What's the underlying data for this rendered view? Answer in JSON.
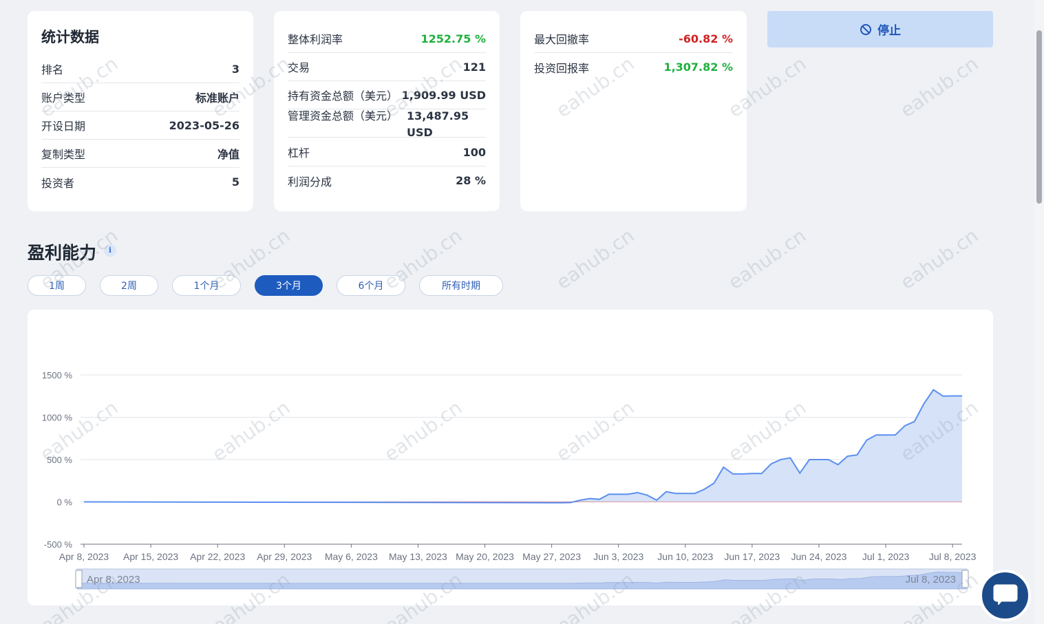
{
  "stats_card": {
    "title": "统计数据",
    "rows": [
      {
        "label": "排名",
        "value": "3"
      },
      {
        "label": "账户类型",
        "value": "标准账户"
      },
      {
        "label": "开设日期",
        "value": "2023-05-26"
      },
      {
        "label": "复制类型",
        "value": "净值"
      },
      {
        "label": "投资者",
        "value": "5"
      }
    ]
  },
  "perf_card": {
    "rows": [
      {
        "label": "整体利润率",
        "value": "1252.75 %"
      },
      {
        "label": "交易",
        "value": "121"
      },
      {
        "label": "持有资金总额（美元）",
        "value": "1,909.99 USD"
      },
      {
        "label": "管理资金总额（美元）",
        "value": "13,487.95 USD"
      },
      {
        "label": "杠杆",
        "value": "100"
      },
      {
        "label": "利润分成",
        "value": "28 %"
      }
    ]
  },
  "risk_card": {
    "rows": [
      {
        "label": "最大回撤率",
        "value": "-60.82 %"
      },
      {
        "label": "投资回报率",
        "value": "1,307.82 %"
      }
    ]
  },
  "stop_button": {
    "label": "停止",
    "icon": "ban-icon"
  },
  "profit_section": {
    "title": "盈利能力",
    "info_icon": "i",
    "tabs": [
      "1周",
      "2周",
      "1个月",
      "3个月",
      "6个月",
      "所有时期"
    ],
    "active_tab": "3个月"
  },
  "colors": {
    "positive": "#1fb03d",
    "negative": "#d12222",
    "accent": "#1d5bbf",
    "line": "#5b8ff0",
    "area": "#d3e0f8"
  },
  "watermark": "eahub.cn",
  "chart_data": {
    "type": "area",
    "title": "",
    "xlabel": "",
    "ylabel": "",
    "ylim": [
      -500,
      1500
    ],
    "y_ticks": [
      "1500 %",
      "1000 %",
      "500 %",
      "0 %",
      "-500 %"
    ],
    "y_tick_values": [
      1500,
      1000,
      500,
      0,
      -500
    ],
    "x_ticks": [
      "Apr 8, 2023",
      "Apr 15, 2023",
      "Apr 22, 2023",
      "Apr 29, 2023",
      "May 6, 2023",
      "May 13, 2023",
      "May 20, 2023",
      "May 27, 2023",
      "Jun 3, 2023",
      "Jun 10, 2023",
      "Jun 17, 2023",
      "Jun 24, 2023",
      "Jul 1, 2023",
      "Jul 8, 2023"
    ],
    "x_range": [
      "2023-04-08",
      "2023-07-09"
    ],
    "grid": true,
    "zoom_start_label": "Apr 8, 2023",
    "zoom_end_label": "Jul 8, 2023",
    "series": [
      {
        "x": [
          "2023-04-08",
          "2023-05-27",
          "2023-05-28",
          "2023-05-29",
          "2023-05-30",
          "2023-05-31",
          "2023-06-01",
          "2023-06-02",
          "2023-06-03",
          "2023-06-04",
          "2023-06-05",
          "2023-06-06",
          "2023-06-07",
          "2023-06-08",
          "2023-06-09",
          "2023-06-10",
          "2023-06-11",
          "2023-06-12",
          "2023-06-13",
          "2023-06-14",
          "2023-06-15",
          "2023-06-16",
          "2023-06-17",
          "2023-06-18",
          "2023-06-19",
          "2023-06-20",
          "2023-06-21",
          "2023-06-22",
          "2023-06-23",
          "2023-06-24",
          "2023-06-25",
          "2023-06-26",
          "2023-06-27",
          "2023-06-28",
          "2023-06-29",
          "2023-06-30",
          "2023-07-01",
          "2023-07-02",
          "2023-07-03",
          "2023-07-04",
          "2023-07-05",
          "2023-07-06",
          "2023-07-07",
          "2023-07-08",
          "2023-07-09"
        ],
        "values": [
          0,
          -10,
          -10,
          -8,
          20,
          40,
          30,
          90,
          90,
          90,
          110,
          80,
          20,
          120,
          100,
          100,
          100,
          150,
          220,
          410,
          330,
          330,
          335,
          335,
          450,
          500,
          520,
          340,
          500,
          500,
          500,
          440,
          540,
          555,
          730,
          790,
          790,
          790,
          900,
          950,
          1160,
          1325,
          1250,
          1252,
          1252
        ]
      }
    ]
  }
}
